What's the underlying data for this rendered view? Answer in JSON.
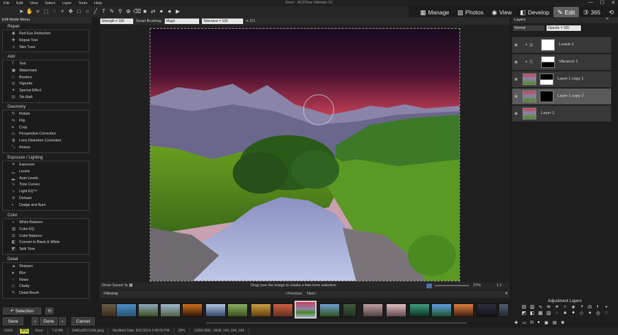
{
  "app": {
    "title": "River - ACDSee Ultimate 10"
  },
  "menu": [
    "File",
    "Edit",
    "View",
    "Select",
    "Layer",
    "Tools",
    "Help"
  ],
  "window_controls": [
    "—",
    "☐",
    "✕"
  ],
  "modes": [
    {
      "label": "Manage",
      "icon": "▦"
    },
    {
      "label": "Photos",
      "icon": "▨"
    },
    {
      "label": "View",
      "icon": "◉"
    },
    {
      "label": "Develop",
      "icon": "◧"
    },
    {
      "label": "Edit",
      "icon": "✎"
    },
    {
      "label": "365",
      "icon": "③"
    }
  ],
  "left_panel": {
    "title": "Edit Mode Menu",
    "groups": [
      {
        "name": "Repair",
        "items": [
          "Red Eye Reduction",
          "Repair Tool",
          "Skin Tune"
        ]
      },
      {
        "name": "Add",
        "items": [
          "Text",
          "Watermark",
          "Borders",
          "Vignette",
          "Special Effect",
          "Tilt-Shift"
        ]
      },
      {
        "name": "Geometry",
        "items": [
          "Rotate",
          "Flip",
          "Crop",
          "Perspective Correction",
          "Lens Distortion Correction",
          "Resize"
        ]
      },
      {
        "name": "Exposure / Lighting",
        "items": [
          "Exposure",
          "Levels",
          "Auto Levels",
          "Tone Curves",
          "Light EQ™",
          "Dehaze",
          "Dodge and Burn"
        ]
      },
      {
        "name": "Color",
        "items": [
          "White Balance",
          "Color EQ",
          "Color Balance",
          "Convert to Black & White",
          "Split Tone"
        ]
      },
      {
        "name": "Detail",
        "items": [
          "Sharpen",
          "Blur",
          "Noise",
          "Clarity",
          "Detail Brush"
        ]
      }
    ],
    "selection_label": "Selection",
    "save_label": "Save",
    "done_label": "Done",
    "cancel_label": "Cancel"
  },
  "options_bar": {
    "strength": "Strength = 100",
    "smart_brushing_label": "Smart Brushing:",
    "smart_brushing_value": "Magic",
    "tolerance": "Tolerance = 100",
    "brush_size": "371"
  },
  "status_strip": {
    "show_saved": "Show Saved",
    "hint": "Drag over the image to create a free-form selection.",
    "zoom": "27%",
    "ratio": "1:1"
  },
  "filmstrip": {
    "title": "Filmstrip",
    "previous": "Previous",
    "next": "Next"
  },
  "layers_panel": {
    "title": "Layers",
    "blend_mode": "Normal",
    "opacity": "Opacity = 100",
    "layers": [
      {
        "name": "Levels 1"
      },
      {
        "name": "Vibrance 1"
      },
      {
        "name": "Layer 1 copy 1"
      },
      {
        "name": "Layer 1 copy 2"
      },
      {
        "name": "Layer 1"
      }
    ],
    "adjustment_title": "Adjustment Layers"
  },
  "bottom_status": {
    "count": "50/65",
    "format": "JPG",
    "name": "River",
    "size": "7.8 MB",
    "dims": "3486x2857x24b jpeg",
    "modified": "Modified Date: 8/11/2014 3:49:09 PM",
    "zoom": "28%",
    "coords": "(1890,958) - RGB: 244, 244, 244"
  },
  "colors": {
    "accent": "#5a5a5a",
    "panel": "#1e1e1e",
    "sky_top": "#2a0b2a",
    "sky_glow": "#e0545e"
  }
}
